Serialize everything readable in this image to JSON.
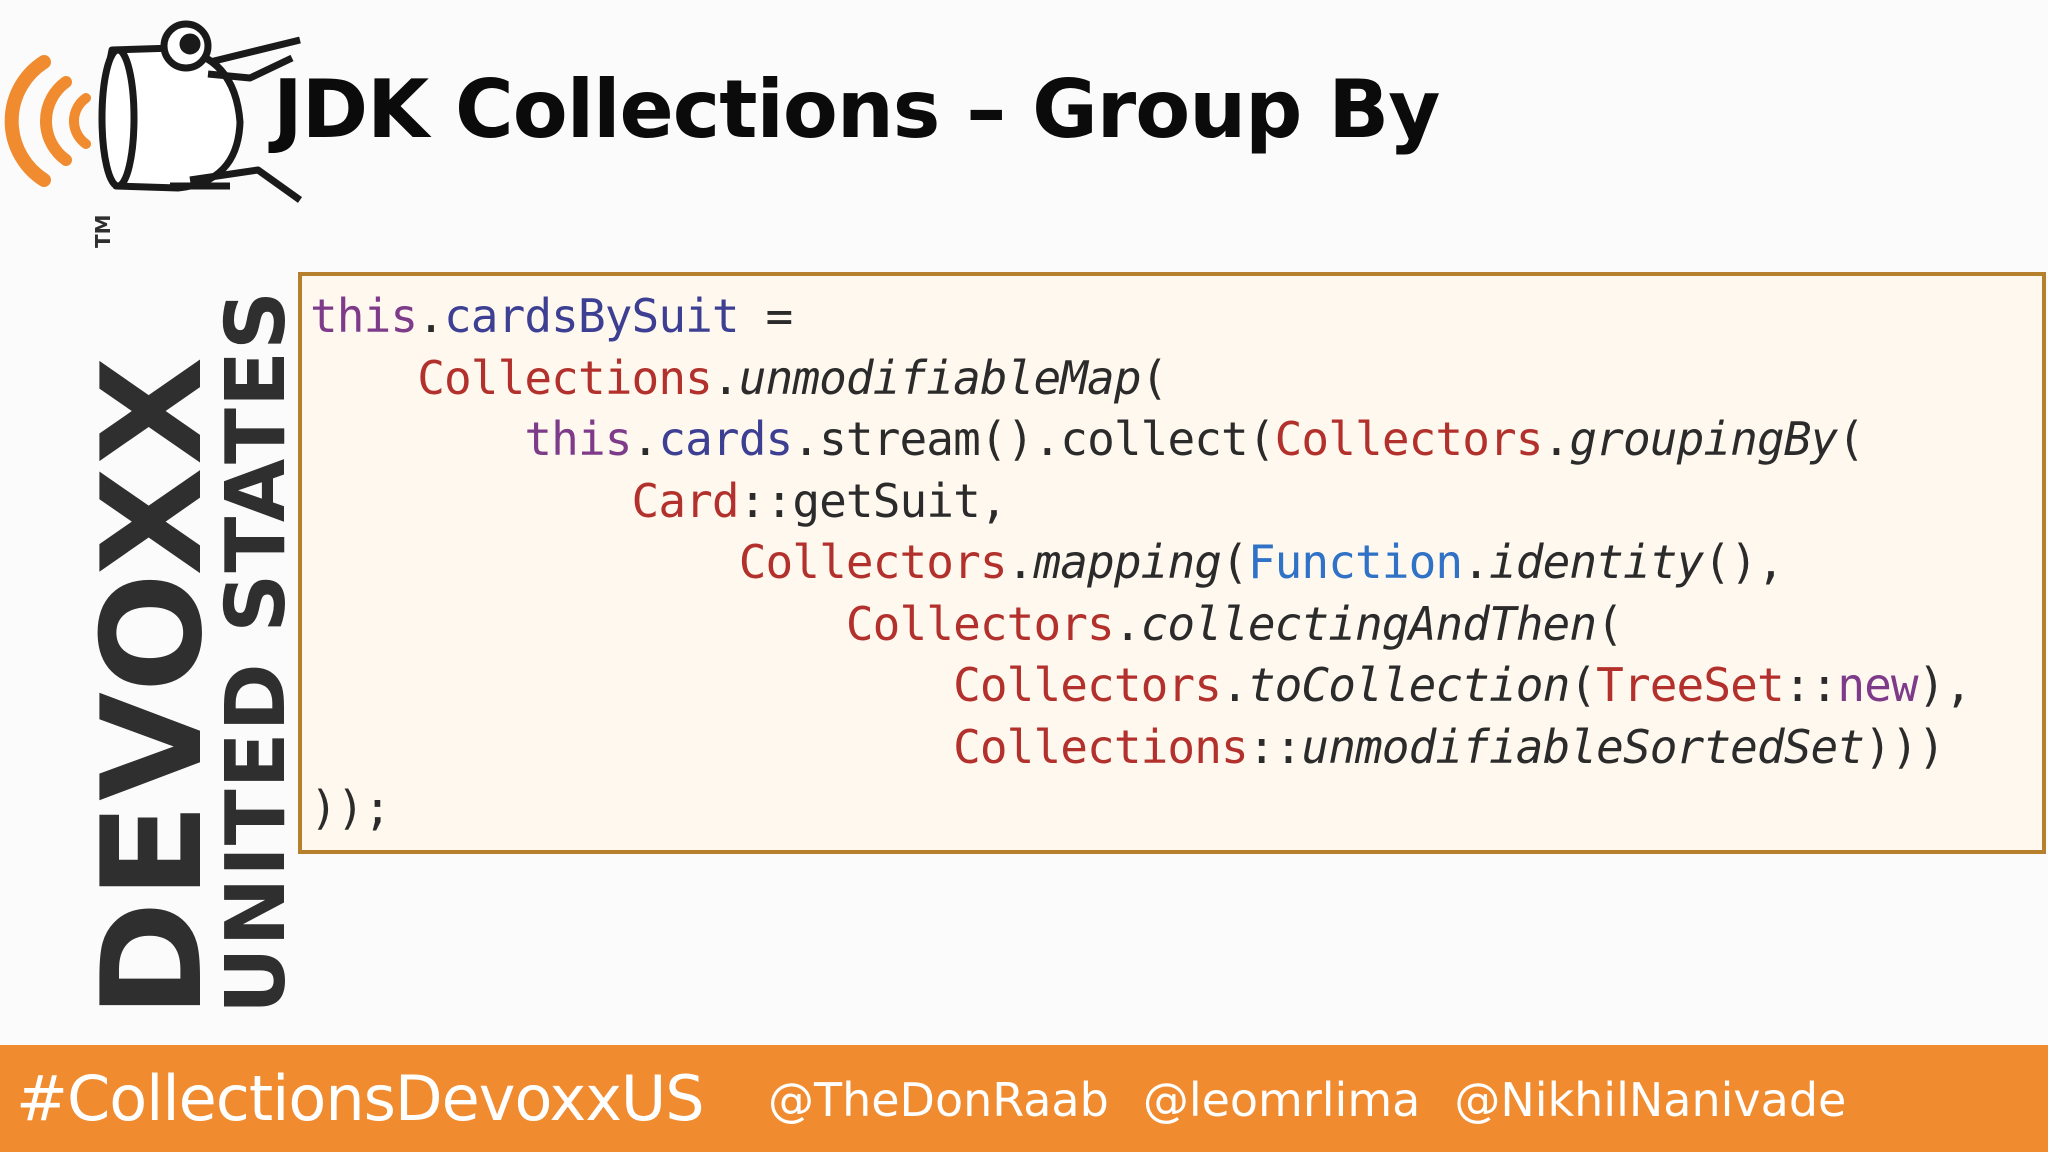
{
  "slide": {
    "title": "JDK Collections – Group By"
  },
  "logo": {
    "brand": "DEVOXX",
    "region": "UNITED STATES",
    "trademark": "TM",
    "brand_color": "#2f2f2f",
    "accent_color": "#f08b2f"
  },
  "code": {
    "lines": [
      [
        {
          "text": "this",
          "style": "kw"
        },
        {
          "text": ".",
          "style": ""
        },
        {
          "text": "cardsBySuit",
          "style": "fld"
        },
        {
          "text": " =",
          "style": ""
        }
      ],
      [
        {
          "text": "    ",
          "style": ""
        },
        {
          "text": "Collections",
          "style": "cls"
        },
        {
          "text": ".",
          "style": ""
        },
        {
          "text": "unmodifiableMap",
          "style": "it"
        },
        {
          "text": "(",
          "style": ""
        }
      ],
      [
        {
          "text": "        ",
          "style": ""
        },
        {
          "text": "this",
          "style": "kw"
        },
        {
          "text": ".",
          "style": ""
        },
        {
          "text": "cards",
          "style": "fld"
        },
        {
          "text": ".stream().collect(",
          "style": ""
        },
        {
          "text": "Collectors",
          "style": "cls"
        },
        {
          "text": ".",
          "style": ""
        },
        {
          "text": "groupingBy",
          "style": "it"
        },
        {
          "text": "(",
          "style": ""
        }
      ],
      [
        {
          "text": "            ",
          "style": ""
        },
        {
          "text": "Card",
          "style": "cls"
        },
        {
          "text": "::getSuit,",
          "style": ""
        }
      ],
      [
        {
          "text": "                ",
          "style": ""
        },
        {
          "text": "Collectors",
          "style": "cls"
        },
        {
          "text": ".",
          "style": ""
        },
        {
          "text": "mapping",
          "style": "it"
        },
        {
          "text": "(",
          "style": ""
        },
        {
          "text": "Function",
          "style": "fn"
        },
        {
          "text": ".",
          "style": ""
        },
        {
          "text": "identity",
          "style": "it"
        },
        {
          "text": "(),",
          "style": ""
        }
      ],
      [
        {
          "text": "                    ",
          "style": ""
        },
        {
          "text": "Collectors",
          "style": "cls"
        },
        {
          "text": ".",
          "style": ""
        },
        {
          "text": "collectingAndThen",
          "style": "it"
        },
        {
          "text": "(",
          "style": ""
        }
      ],
      [
        {
          "text": "                        ",
          "style": ""
        },
        {
          "text": "Collectors",
          "style": "cls"
        },
        {
          "text": ".",
          "style": ""
        },
        {
          "text": "toCollection",
          "style": "it"
        },
        {
          "text": "(",
          "style": ""
        },
        {
          "text": "TreeSet",
          "style": "cls"
        },
        {
          "text": "::",
          "style": ""
        },
        {
          "text": "new",
          "style": "kw"
        },
        {
          "text": "),",
          "style": ""
        }
      ],
      [
        {
          "text": "                        ",
          "style": ""
        },
        {
          "text": "Collections",
          "style": "cls"
        },
        {
          "text": "::",
          "style": ""
        },
        {
          "text": "unmodifiableSortedSet",
          "style": "it"
        },
        {
          "text": ")))",
          "style": ""
        }
      ],
      [
        {
          "text": "));",
          "style": ""
        }
      ]
    ],
    "colors": {
      "keyword": "#7d3b8a",
      "field": "#3d3f93",
      "class": "#b3312c",
      "function_class": "#2f72c6",
      "box_border": "#b7802d",
      "box_background": "#fff8ef"
    }
  },
  "footer": {
    "hashtag": "#CollectionsDevoxxUS",
    "handles": [
      "@TheDonRaab",
      "@leomrlima",
      "@NikhilNanivade"
    ],
    "background_color": "#f08b2f"
  }
}
